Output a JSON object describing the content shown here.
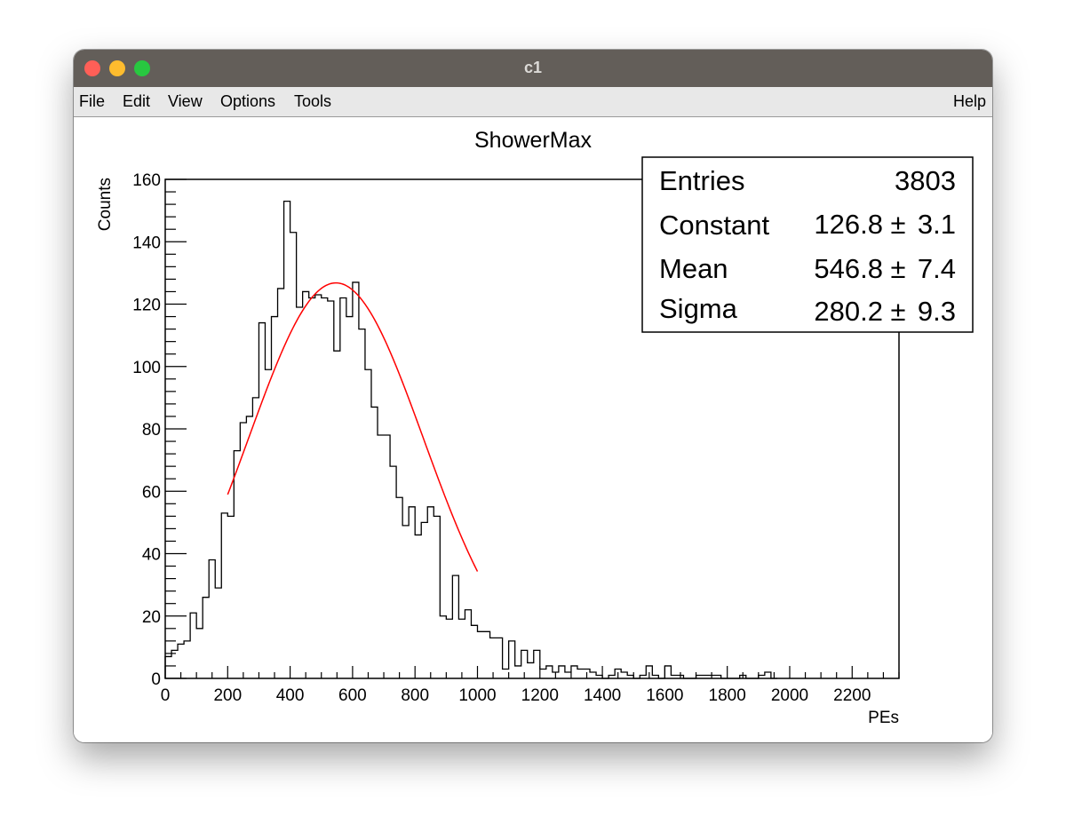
{
  "window": {
    "title": "c1"
  },
  "menu": {
    "file": "File",
    "edit": "Edit",
    "view": "View",
    "options": "Options",
    "tools": "Tools",
    "help": "Help"
  },
  "stats": {
    "entries_label": "Entries",
    "entries_value": "3803",
    "constant_label": "Constant",
    "constant_value": "126.8",
    "constant_err": "3.1",
    "mean_label": "Mean",
    "mean_value": "546.8",
    "mean_err": "7.4",
    "sigma_label": "Sigma",
    "sigma_value": "280.2",
    "sigma_err": "9.3",
    "pm": "±"
  },
  "colors": {
    "histogram": "#000000",
    "fit": "#ff0000",
    "titlebar": "#635e59"
  },
  "chart_data": {
    "type": "histogram",
    "title": "ShowerMax",
    "xlabel": "PEs",
    "ylabel": "Counts",
    "xlim": [
      0,
      2350
    ],
    "ylim": [
      0,
      160
    ],
    "bin_width": 20,
    "x_ticks": [
      0,
      200,
      400,
      600,
      800,
      1000,
      1200,
      1400,
      1600,
      1800,
      2000,
      2200
    ],
    "y_ticks": [
      0,
      20,
      40,
      60,
      80,
      100,
      120,
      140,
      160
    ],
    "grid": false,
    "legend": "top-right stats box",
    "bin_values": [
      7,
      9,
      11,
      12,
      21,
      16,
      26,
      38,
      29,
      53,
      52,
      73,
      82,
      84,
      90,
      114,
      99,
      116,
      125,
      153,
      143,
      119,
      124,
      122,
      123,
      122,
      121,
      105,
      122,
      116,
      127,
      112,
      99,
      87,
      78,
      78,
      68,
      58,
      49,
      55,
      46,
      50,
      55,
      52,
      20,
      19,
      33,
      19,
      22,
      17,
      15,
      15,
      13,
      13,
      3,
      12,
      4,
      9,
      5,
      9,
      3,
      4,
      2,
      4,
      2,
      4,
      3,
      3,
      2,
      1,
      0,
      1,
      3,
      2,
      1,
      0,
      1,
      4,
      1,
      0,
      4,
      1,
      1,
      0,
      0,
      1,
      1,
      1,
      1,
      0,
      0,
      0,
      1,
      0,
      0,
      1,
      2,
      0
    ],
    "fit": {
      "function": "gaus",
      "constant": 126.8,
      "mean": 546.8,
      "sigma": 280.2,
      "range": [
        200,
        1000
      ]
    }
  }
}
